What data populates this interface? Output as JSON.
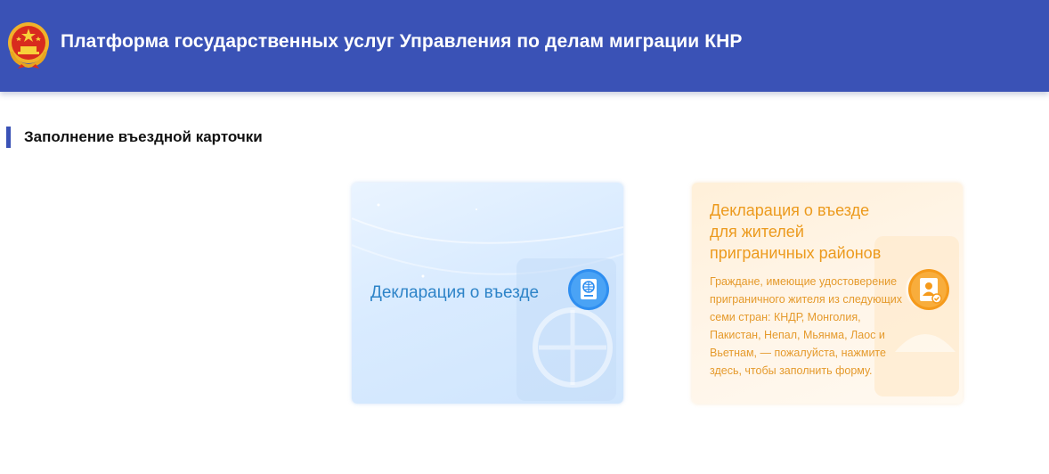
{
  "header": {
    "emblem_icon": "national-emblem-icon",
    "title": "Платформа государственных услуг Управления по делам миграции КНР",
    "background_color": "#3a52b6"
  },
  "section": {
    "title": "Заполнение въездной карточки"
  },
  "cards": [
    {
      "title": "Декларация о въезде",
      "icon": "passport-globe-icon",
      "theme_color": "#2e84c8"
    },
    {
      "title_lines": [
        "Декларация о въезде",
        "для жителей",
        "приграничных районов"
      ],
      "description": "Граждане, имеющие удостоверение приграничного жителя из следующих семи стран: КНДР, Монголия, Пакистан, Непал, Мьянма, Лаос и Вьетнам, — пожалуйста, нажмите здесь, чтобы заполнить форму.",
      "icon": "id-card-icon",
      "theme_color": "#ec9a1d"
    }
  ]
}
